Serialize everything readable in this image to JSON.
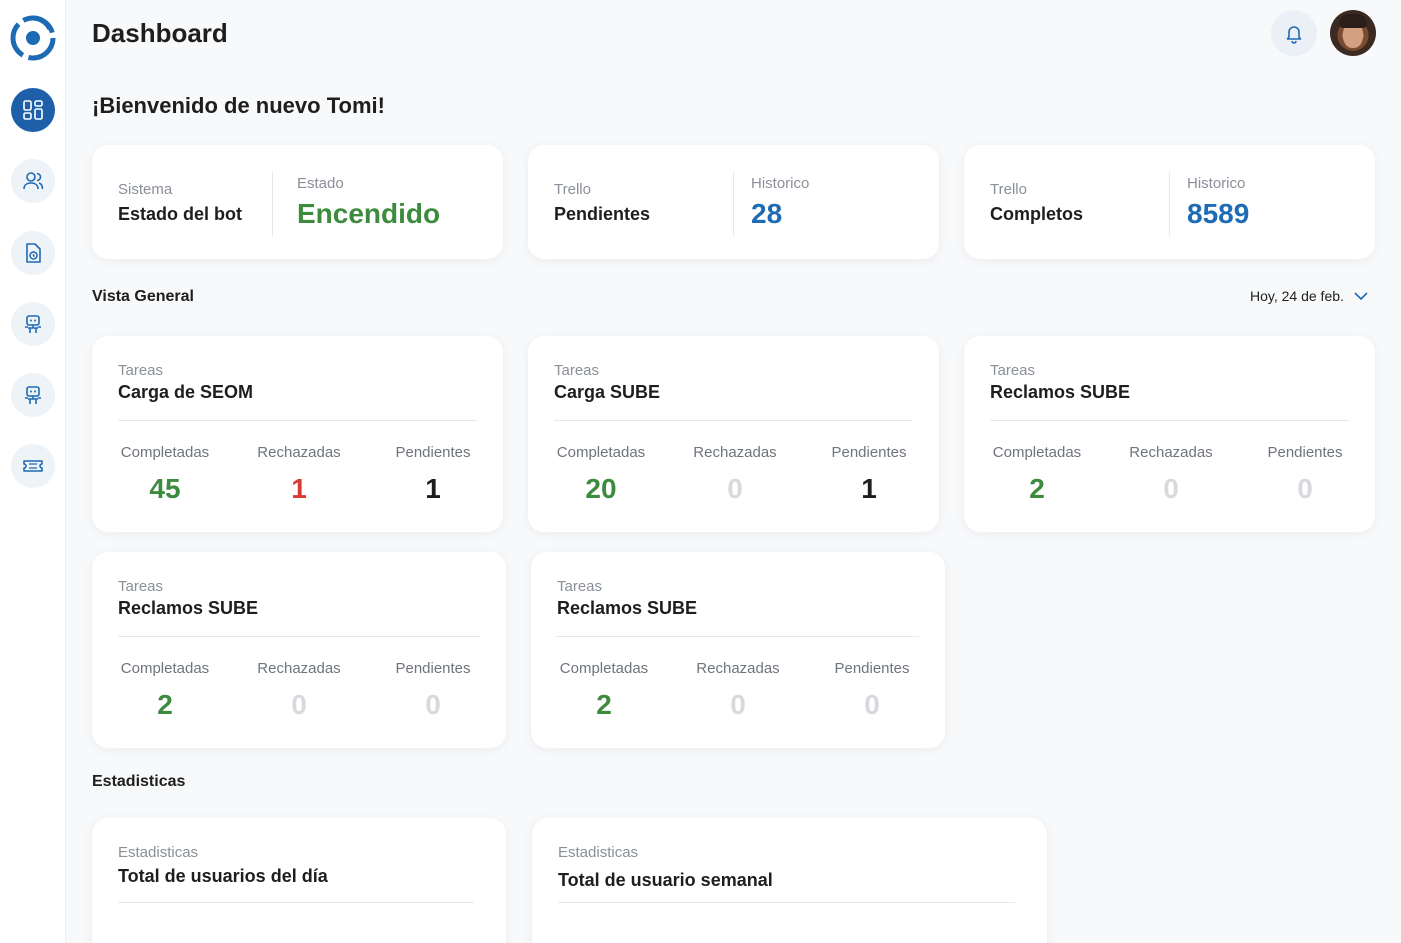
{
  "header": {
    "title": "Dashboard"
  },
  "welcome": "¡Bienvenido de nuevo Tomi!",
  "sidebar": {
    "items": [
      {
        "icon": "grid-icon",
        "active": true
      },
      {
        "icon": "users-icon",
        "active": false
      },
      {
        "icon": "document-clock-icon",
        "active": false
      },
      {
        "icon": "robot-icon",
        "active": false
      },
      {
        "icon": "robot-icon",
        "active": false
      },
      {
        "icon": "ticket-icon",
        "active": false
      }
    ]
  },
  "top_cards": [
    {
      "left_kicker": "Sistema",
      "left_title": "Estado del bot",
      "right_kicker": "Estado",
      "right_value": "Encendido"
    },
    {
      "left_kicker": "Trello",
      "left_title": "Pendientes",
      "right_kicker": "Historico",
      "right_value": "28"
    },
    {
      "left_kicker": "Trello",
      "left_title": "Completos",
      "right_kicker": "Historico",
      "right_value": "8589"
    }
  ],
  "overview": {
    "title": "Vista General",
    "date_filter": "Hoy, 24 de feb."
  },
  "metric_labels": {
    "completed": "Completadas",
    "rejected": "Rechazadas",
    "pending": "Pendientes"
  },
  "task_cards": [
    {
      "kicker": "Tareas",
      "name": "Carga de SEOM",
      "completed": "45",
      "rejected": "1",
      "pending": "1"
    },
    {
      "kicker": "Tareas",
      "name": "Carga SUBE",
      "completed": "20",
      "rejected": "0",
      "pending": "1"
    },
    {
      "kicker": "Tareas",
      "name": "Reclamos SUBE",
      "completed": "2",
      "rejected": "0",
      "pending": "0"
    },
    {
      "kicker": "Tareas",
      "name": "Reclamos SUBE",
      "completed": "2",
      "rejected": "0",
      "pending": "0"
    },
    {
      "kicker": "Tareas",
      "name": "Reclamos SUBE",
      "completed": "2",
      "rejected": "0",
      "pending": "0"
    }
  ],
  "statistics": {
    "title": "Estadisticas",
    "cards": [
      {
        "kicker": "Estadisticas",
        "name": "Total de usuarios del día"
      },
      {
        "kicker": "Estadisticas",
        "name": "Total de usuario semanal"
      }
    ]
  },
  "colors": {
    "accent": "#1d5fa9",
    "success": "#3d8b3d",
    "danger": "#d93a34",
    "zero": "#d7d9dd"
  }
}
